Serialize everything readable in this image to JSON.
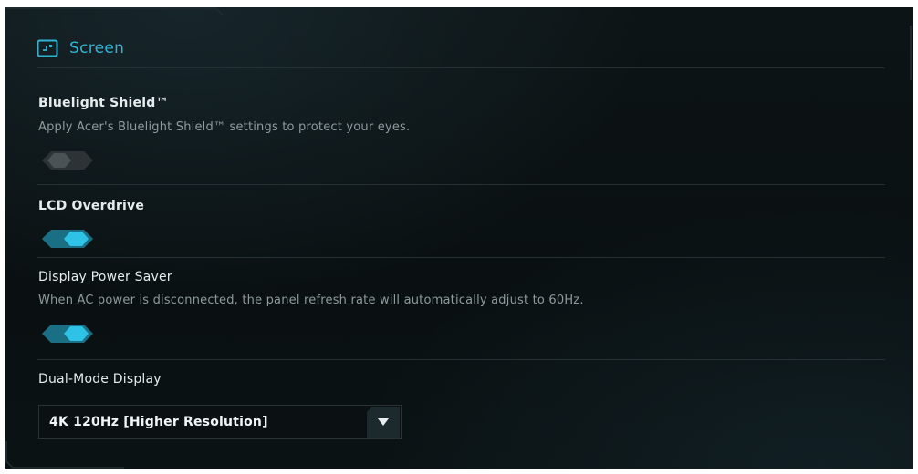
{
  "section": {
    "title": "Screen",
    "icon": "screen-icon"
  },
  "colors": {
    "accent": "#2fb5d4",
    "toggle_on": "#1fa9c9",
    "toggle_off": "#3a4144",
    "background": "#0b1214"
  },
  "settings": {
    "bluelight": {
      "title": "Bluelight Shield™",
      "description": "Apply Acer's Bluelight Shield™ settings to protect your eyes.",
      "state": "off"
    },
    "lcd_overdrive": {
      "title": "LCD Overdrive",
      "state": "on"
    },
    "power_saver": {
      "title": "Display Power Saver",
      "description": "When AC power is disconnected, the panel refresh rate will automatically adjust to 60Hz.",
      "state": "on"
    },
    "dual_mode": {
      "title": "Dual-Mode Display",
      "selected": "4K 120Hz [Higher Resolution]",
      "icon": "dropdown-arrow-icon"
    }
  }
}
